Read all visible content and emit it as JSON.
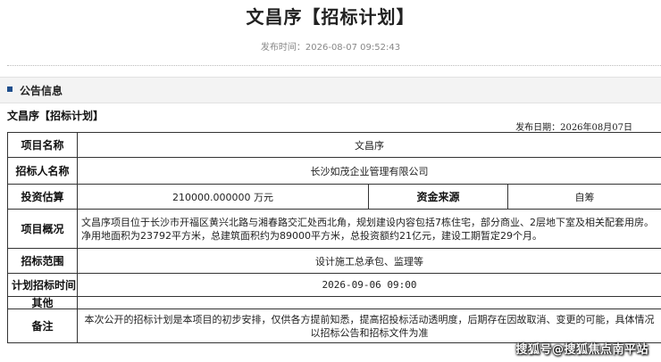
{
  "header": {
    "title": "文昌序【招标计划】",
    "publish_time": "发布时间：2026-08-07 09:52:43"
  },
  "section": {
    "title": "公告信息"
  },
  "document": {
    "heading": "文昌序【招标计划】",
    "date": "发布日期：2026年08月07日"
  },
  "table": {
    "project_name_label": "项目名称",
    "project_name": "文昌序",
    "tenderer_label": "招标人名称",
    "tenderer": "长沙如茂企业管理有限公司",
    "investment_label": "投资估算",
    "investment": "210000.000000 万元",
    "fund_source_label": "资金来源",
    "fund_source": "自筹",
    "overview_label": "项目概况",
    "overview": "文昌序项目位于长沙市开福区黄兴北路与湘春路交汇处西北角，规划建设内容包括7栋住宅，部分商业、2层地下室及相关配套用房。净用地面积为23792平方米，总建筑面积约为89000平方米，总投资额约21亿元，建设工期暂定29个月。",
    "scope_label": "招标范围",
    "scope": "设计施工总承包、监理等",
    "plan_time_label": "计划招标时间",
    "plan_time": "2026-09-06 09:00",
    "other_label": "其他",
    "other": "",
    "remark_label": "备注",
    "remark": "本次公开的招标计划是本项目的初步安排，仅供各方提前知悉，提高招投标活动透明度，后期存在因故取消、变更的可能，具体情况以招标公告和招标文件为准"
  },
  "watermark": "搜狐号@搜狐焦点南平站"
}
